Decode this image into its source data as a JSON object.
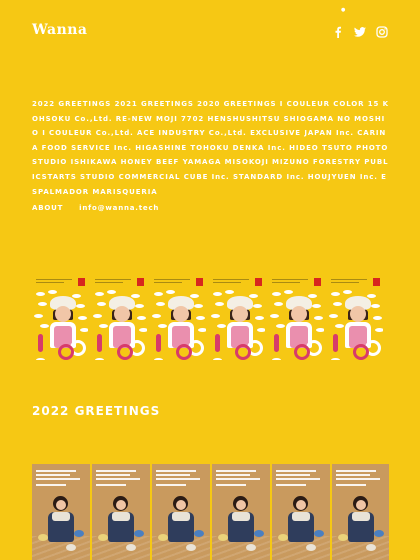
{
  "header": {
    "logo": "Wanna",
    "tiny_mark": "●",
    "social": [
      {
        "name": "facebook",
        "icon": "facebook-icon"
      },
      {
        "name": "twitter",
        "icon": "twitter-icon"
      },
      {
        "name": "instagram",
        "icon": "instagram-icon"
      }
    ]
  },
  "clients_text": "2022 GREETINGS 2021 GREETINGS 2020 GREETINGS I COULEUR COLOR 15 KOHSOKU Co.,Ltd. RE-NEW MOJI 7702 HENSHUSHITSU SHIOGAMA NO MOSHIO I COULEUR Co.,Ltd. ACE INDUSTRY Co.,Ltd. EXCLUSIVE JAPAN Inc. CARINA FOOD SERVICE Inc. HIGASHINE TOHOKU DENKA Inc. HIDEO TSUTO PHOTO STUDIO ISHIKAWA HONEY BEEF YAMAGA MISOKOJI MIZUNO FORESTRY PUBLICSTARTS STUDIO COMMERCIAL CUBE Inc. STANDARD Inc. HOUJYUEN Inc. ESPALMADOR MARISQUERIA",
  "links": {
    "about": "ABOUT",
    "email": "info@wanna.tech"
  },
  "sections": [
    {
      "title": "2022 GREETINGS"
    }
  ],
  "colors": {
    "background": "#F6C814",
    "text": "#FFFFFF",
    "poster_brown": "#C99A5E",
    "stamp_red": "#D7261E"
  }
}
